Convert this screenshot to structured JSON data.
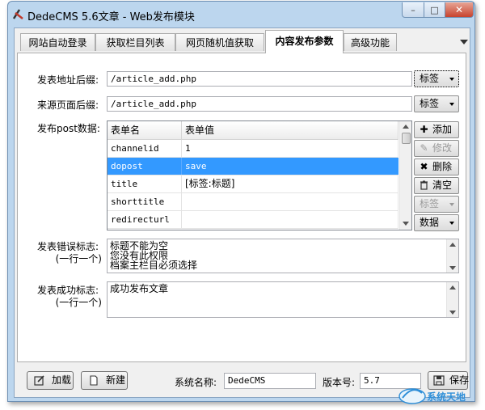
{
  "window": {
    "title": "DedeCMS 5.6文章 - Web发布模块",
    "controls": {
      "minimize": "–",
      "maximize": "□",
      "close": "✕"
    }
  },
  "tabs": [
    {
      "label": "网站自动登录",
      "active": false
    },
    {
      "label": "获取栏目列表",
      "active": false
    },
    {
      "label": "网页随机值获取",
      "active": false
    },
    {
      "label": "内容发布参数",
      "active": true
    },
    {
      "label": "高级功能",
      "active": false
    }
  ],
  "form": {
    "post_url": {
      "label": "发表地址后缀:",
      "value": "/article_add.php",
      "tag_button": "标签"
    },
    "referer": {
      "label": "来源页面后缀:",
      "value": "/article_add.php",
      "tag_button": "标签"
    },
    "post_data": {
      "label": "发布post数据:",
      "columns": [
        "表单名",
        "表单值"
      ],
      "rows": [
        {
          "name": "channelid",
          "value": "1",
          "selected": false
        },
        {
          "name": "dopost",
          "value": "save",
          "selected": true
        },
        {
          "name": "title",
          "value": "[标签:标题]",
          "selected": false
        },
        {
          "name": "shorttitle",
          "value": "",
          "selected": false
        },
        {
          "name": "redirecturl",
          "value": "",
          "selected": false
        }
      ]
    },
    "side_buttons": {
      "add": "添加",
      "edit": "修改",
      "delete": "删除",
      "clear": "清空",
      "tag": "标签",
      "data": "数据"
    },
    "error_marks": {
      "label": "发表错误标志:",
      "hint": "(一行一个)",
      "lines": [
        "标题不能为空",
        "您没有此权限",
        "档案主栏目必须选择"
      ]
    },
    "success_marks": {
      "label": "发表成功标志:",
      "hint": "(一行一个)",
      "lines": [
        "成功发布文章"
      ]
    }
  },
  "footer": {
    "load_button": "加载",
    "new_button": "新建",
    "system_name_label": "系统名称:",
    "system_name_value": "DedeCMS",
    "version_label": "版本号:",
    "version_value": "5.7",
    "save_button": "保存"
  },
  "watermark": {
    "text": "系统天地"
  },
  "colors": {
    "selection": "#3399ff",
    "frame": "#bcd6ee",
    "delete_icon": "#222222",
    "add_icon": "#1a1a1a"
  }
}
